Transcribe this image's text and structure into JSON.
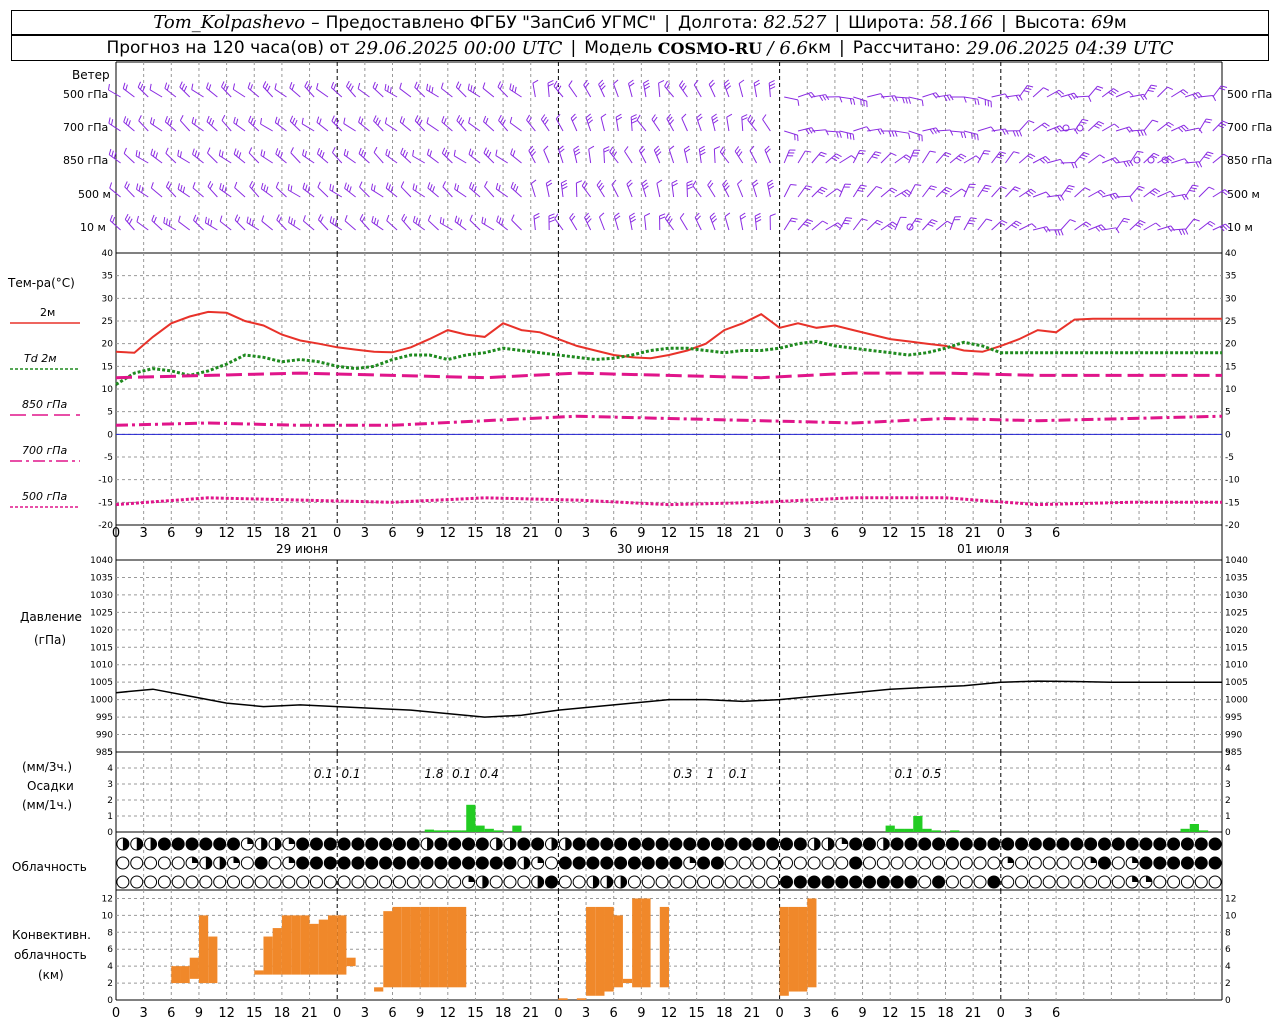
{
  "header": {
    "station": "Tom_Kolpashevo",
    "provider_prefix": "–",
    "provider": "Предоставлено ФГБУ \"ЗапСиб УГМС\"",
    "lon_label": "Долгота:",
    "lon_value": "82.527",
    "lat_label": "Широта:",
    "lat_value": "58.166",
    "alt_label": "Высота:",
    "alt_value": "69",
    "alt_unit": "м",
    "forecast_label": "Прогноз на 120 часа(ов) от",
    "forecast_start": "29.06.2025 00:00 UTC",
    "model_label": "Модель",
    "model_name": "COSMO-RU",
    "model_res": "/ 6.6",
    "model_res_unit": "км",
    "calc_label": "Рассчитано:",
    "calc_time": "29.06.2025 04:39 UTC"
  },
  "wind_panel": {
    "title": "Ветер",
    "levels": [
      "500 гПа",
      "700 гПа",
      "850 гПа",
      "500 м",
      "10 м"
    ]
  },
  "temp_panel": {
    "title": "Тем-ра(°С)",
    "legend": [
      "2м",
      "Td 2м",
      "850 гПа",
      "700 гПа",
      "500 гПа"
    ]
  },
  "pressure_panel": {
    "title_1": "Давление",
    "title_2": "(гПа)"
  },
  "precip_panel": {
    "unit_3h": "(мм/3ч.)",
    "title": "Осадки",
    "unit_1h": "(мм/1ч.)"
  },
  "cloud_panel": {
    "title": "Облачность"
  },
  "conv_panel": {
    "title_1": "Конвективн.",
    "title_2": "облачность",
    "title_3": "(км)"
  },
  "days": [
    "29 июня",
    "30 июня",
    "01 июля"
  ],
  "hour_ticks": [
    "0",
    "3",
    "6",
    "9",
    "12",
    "15",
    "18",
    "21",
    "0",
    "3",
    "6",
    "9",
    "12",
    "15",
    "18",
    "21",
    "0",
    "3",
    "6",
    "9",
    "12",
    "15",
    "18",
    "21",
    "0",
    "3",
    "6",
    "9",
    "12",
    "15",
    "18",
    "21",
    "0",
    "3",
    "6"
  ],
  "colors": {
    "wind": "#8a2be2",
    "t2m": "#e8322a",
    "td2m": "#1f8a1f",
    "t850": "#e0158a",
    "t700": "#e0158a",
    "t500": "#e0158a",
    "zero_line": "#2020d0",
    "precip": "#22cc22",
    "conv": "#f0882a",
    "grid": "#999999"
  },
  "chart_data": [
    {
      "type": "line",
      "title": "Тем-ра(°С)",
      "x_unit": "hours since 29.06.2025 00:00 UTC",
      "ylim": [
        -20,
        40
      ],
      "yticks": [
        -20,
        -15,
        -10,
        -5,
        0,
        5,
        10,
        15,
        20,
        25,
        30,
        35,
        40
      ],
      "series": [
        {
          "name": "2м",
          "x": [
            0,
            2,
            4,
            6,
            8,
            10,
            12,
            14,
            16,
            18,
            20,
            22,
            24,
            26,
            28,
            30,
            32,
            34,
            36,
            38,
            40,
            42,
            44,
            46,
            48,
            50,
            52,
            54,
            56,
            58,
            60,
            62,
            64,
            66,
            68,
            70,
            72,
            74,
            76,
            78,
            80,
            82,
            84,
            86,
            88,
            90,
            92,
            94,
            96,
            98,
            100,
            102,
            104,
            106,
            108,
            110,
            112,
            114,
            116,
            118,
            120
          ],
          "y": [
            18.2,
            18,
            21.5,
            24.5,
            26,
            27,
            26.8,
            25,
            24,
            22,
            20.7,
            20,
            19.2,
            18.7,
            18.2,
            18.1,
            19.2,
            21,
            23,
            22,
            21.5,
            24.5,
            23,
            22.5,
            21,
            19.5,
            18.5,
            17.5,
            17,
            16.8,
            17.5,
            18.5,
            20,
            23,
            24.5,
            26.5,
            23.5,
            24.5,
            23.5,
            24,
            23,
            22,
            21,
            20.5,
            20,
            19.5,
            18.5,
            18.2,
            19.5,
            21,
            23,
            22.5,
            25.3,
            25.5,
            25.5,
            25.5,
            25.5,
            25.5,
            25.5,
            25.5,
            25.5
          ]
        },
        {
          "name": "Td 2м",
          "x": [
            0,
            2,
            4,
            6,
            8,
            10,
            12,
            14,
            16,
            18,
            20,
            22,
            24,
            26,
            28,
            30,
            32,
            34,
            36,
            38,
            40,
            42,
            44,
            46,
            48,
            50,
            52,
            54,
            56,
            58,
            60,
            62,
            64,
            66,
            68,
            70,
            72,
            74,
            76,
            78,
            80,
            82,
            84,
            86,
            88,
            90,
            92,
            94,
            96,
            98,
            100,
            102,
            104,
            106,
            108,
            110,
            112,
            114,
            116,
            118,
            120
          ],
          "y": [
            11,
            13.5,
            14.5,
            14,
            13,
            14,
            15.5,
            17.5,
            17,
            16,
            16.5,
            16,
            15,
            14.5,
            15,
            16.5,
            17.5,
            17.5,
            16.5,
            17.5,
            18,
            19,
            18.5,
            18,
            17.5,
            17,
            16.5,
            16.8,
            17.5,
            18.5,
            19,
            19,
            18.5,
            18,
            18.5,
            18.5,
            19,
            20,
            20.5,
            19.5,
            19,
            18.5,
            18,
            17.5,
            18,
            19,
            20.3,
            19.5,
            18,
            18,
            18,
            18,
            18,
            18,
            18,
            18,
            18,
            18,
            18,
            18,
            18
          ]
        },
        {
          "name": "850 гПа",
          "x": [
            0,
            10,
            20,
            30,
            40,
            50,
            60,
            70,
            80,
            90,
            100,
            110,
            120
          ],
          "y": [
            12.5,
            13,
            13.5,
            13,
            12.5,
            13.5,
            13,
            12.5,
            13.5,
            13.5,
            13,
            13,
            13
          ]
        },
        {
          "name": "700 гПа",
          "x": [
            0,
            10,
            20,
            30,
            40,
            50,
            60,
            70,
            80,
            90,
            100,
            110,
            120
          ],
          "y": [
            2,
            2.5,
            2,
            2,
            3,
            4,
            3.5,
            3,
            2.5,
            3.5,
            3,
            3.5,
            4
          ]
        },
        {
          "name": "500 гПа",
          "x": [
            0,
            10,
            20,
            30,
            40,
            50,
            60,
            70,
            80,
            90,
            100,
            110,
            120
          ],
          "y": [
            -15.5,
            -14,
            -14.5,
            -15,
            -14,
            -14.5,
            -15.5,
            -15,
            -14,
            -14,
            -15.5,
            -15,
            -15
          ]
        }
      ]
    },
    {
      "type": "line",
      "title": "Давление (гПа)",
      "ylim": [
        985,
        1040
      ],
      "yticks": [
        985,
        990,
        995,
        1000,
        1005,
        1010,
        1015,
        1020,
        1025,
        1030,
        1035,
        1040
      ],
      "series": [
        {
          "x": [
            0,
            4,
            8,
            12,
            16,
            20,
            24,
            28,
            32,
            36,
            40,
            44,
            48,
            52,
            56,
            60,
            64,
            68,
            72,
            76,
            80,
            84,
            88,
            92,
            96,
            100,
            104,
            108,
            112,
            116,
            120
          ],
          "y": [
            1002,
            1003,
            1001,
            999,
            998,
            998.5,
            998,
            997.5,
            997,
            996,
            995,
            995.5,
            997,
            998,
            999,
            1000,
            1000,
            999.5,
            1000,
            1001,
            1002,
            1003,
            1003.5,
            1004,
            1005,
            1005.3,
            1005.2,
            1005,
            1005,
            1005,
            1005
          ]
        }
      ]
    },
    {
      "type": "bar",
      "title": "Осадки",
      "ylim": [
        0,
        5
      ],
      "yticks": [
        0,
        1,
        2,
        3,
        4,
        5
      ],
      "bars_1h": [
        {
          "x": 34,
          "y": 0.15
        },
        {
          "x": 35,
          "y": 0.1
        },
        {
          "x": 36,
          "y": 0.1
        },
        {
          "x": 37,
          "y": 0.1
        },
        {
          "x": 38,
          "y": 0.1
        },
        {
          "x": 38.5,
          "y": 1.7
        },
        {
          "x": 39.5,
          "y": 0.4
        },
        {
          "x": 40.5,
          "y": 0.2
        },
        {
          "x": 41.5,
          "y": 0.1
        },
        {
          "x": 43.5,
          "y": 0.4
        },
        {
          "x": 84,
          "y": 0.4
        },
        {
          "x": 85,
          "y": 0.2
        },
        {
          "x": 86,
          "y": 0.2
        },
        {
          "x": 87,
          "y": 1.0
        },
        {
          "x": 88,
          "y": 0.2
        },
        {
          "x": 89,
          "y": 0.1
        },
        {
          "x": 91,
          "y": 0.1
        },
        {
          "x": 116,
          "y": 0.2
        },
        {
          "x": 117,
          "y": 0.5
        },
        {
          "x": 118,
          "y": 0.1
        }
      ],
      "labels_3h": [
        {
          "x": 22.5,
          "text": "0.1"
        },
        {
          "x": 25.5,
          "text": "0.1"
        },
        {
          "x": 34.5,
          "text": "1.8"
        },
        {
          "x": 37.5,
          "text": "0.1"
        },
        {
          "x": 40.5,
          "text": "0.4"
        },
        {
          "x": 61.5,
          "text": "0.3"
        },
        {
          "x": 64.5,
          "text": "1"
        },
        {
          "x": 67.5,
          "text": "0.1"
        },
        {
          "x": 85.5,
          "text": "0.1"
        },
        {
          "x": 88.5,
          "text": "0.5"
        }
      ]
    },
    {
      "type": "bar",
      "title": "Конвективн. облачность (км)",
      "ylim": [
        0,
        13
      ],
      "yticks": [
        0,
        2,
        4,
        6,
        8,
        10,
        12
      ],
      "bars": [
        {
          "x": 6.5,
          "lo": 2,
          "hi": 4
        },
        {
          "x": 7.5,
          "lo": 2,
          "hi": 4
        },
        {
          "x": 8.5,
          "lo": 2.5,
          "hi": 5
        },
        {
          "x": 9.5,
          "lo": 2,
          "hi": 10
        },
        {
          "x": 10.5,
          "lo": 2,
          "hi": 7.5
        },
        {
          "x": 15.5,
          "lo": 3,
          "hi": 3.5
        },
        {
          "x": 16.5,
          "lo": 3,
          "hi": 7.5
        },
        {
          "x": 17.5,
          "lo": 3,
          "hi": 8.5
        },
        {
          "x": 18.5,
          "lo": 3,
          "hi": 10
        },
        {
          "x": 19.5,
          "lo": 3,
          "hi": 10
        },
        {
          "x": 20.5,
          "lo": 3,
          "hi": 10
        },
        {
          "x": 21.5,
          "lo": 3,
          "hi": 9
        },
        {
          "x": 22.5,
          "lo": 3,
          "hi": 9.5
        },
        {
          "x": 23.5,
          "lo": 3,
          "hi": 10
        },
        {
          "x": 24.5,
          "lo": 3,
          "hi": 10
        },
        {
          "x": 25.5,
          "lo": 4,
          "hi": 5
        },
        {
          "x": 28.5,
          "lo": 1,
          "hi": 1.5
        },
        {
          "x": 29.5,
          "lo": 1.5,
          "hi": 10.5
        },
        {
          "x": 30.5,
          "lo": 1.5,
          "hi": 11
        },
        {
          "x": 31.5,
          "lo": 1.5,
          "hi": 11
        },
        {
          "x": 32.5,
          "lo": 1.5,
          "hi": 11
        },
        {
          "x": 33.5,
          "lo": 1.5,
          "hi": 11
        },
        {
          "x": 34.5,
          "lo": 1.5,
          "hi": 11
        },
        {
          "x": 35.5,
          "lo": 1.5,
          "hi": 11
        },
        {
          "x": 36.5,
          "lo": 1.5,
          "hi": 11
        },
        {
          "x": 37.5,
          "lo": 1.5,
          "hi": 11
        },
        {
          "x": 48.5,
          "lo": 0,
          "hi": 0.2
        },
        {
          "x": 50.5,
          "lo": 0,
          "hi": 0.2
        },
        {
          "x": 51.5,
          "lo": 0.5,
          "hi": 11
        },
        {
          "x": 52.5,
          "lo": 0.5,
          "hi": 11
        },
        {
          "x": 53.5,
          "lo": 1,
          "hi": 11
        },
        {
          "x": 54.5,
          "lo": 1.5,
          "hi": 10
        },
        {
          "x": 55.5,
          "lo": 2,
          "hi": 2.5
        },
        {
          "x": 56.5,
          "lo": 1.5,
          "hi": 12
        },
        {
          "x": 57.5,
          "lo": 1.5,
          "hi": 12
        },
        {
          "x": 59.5,
          "lo": 1.5,
          "hi": 11
        },
        {
          "x": 72.5,
          "lo": 0.5,
          "hi": 11
        },
        {
          "x": 73.5,
          "lo": 1,
          "hi": 11
        },
        {
          "x": 74.5,
          "lo": 1,
          "hi": 11
        },
        {
          "x": 75.5,
          "lo": 1.5,
          "hi": 12
        }
      ]
    }
  ]
}
